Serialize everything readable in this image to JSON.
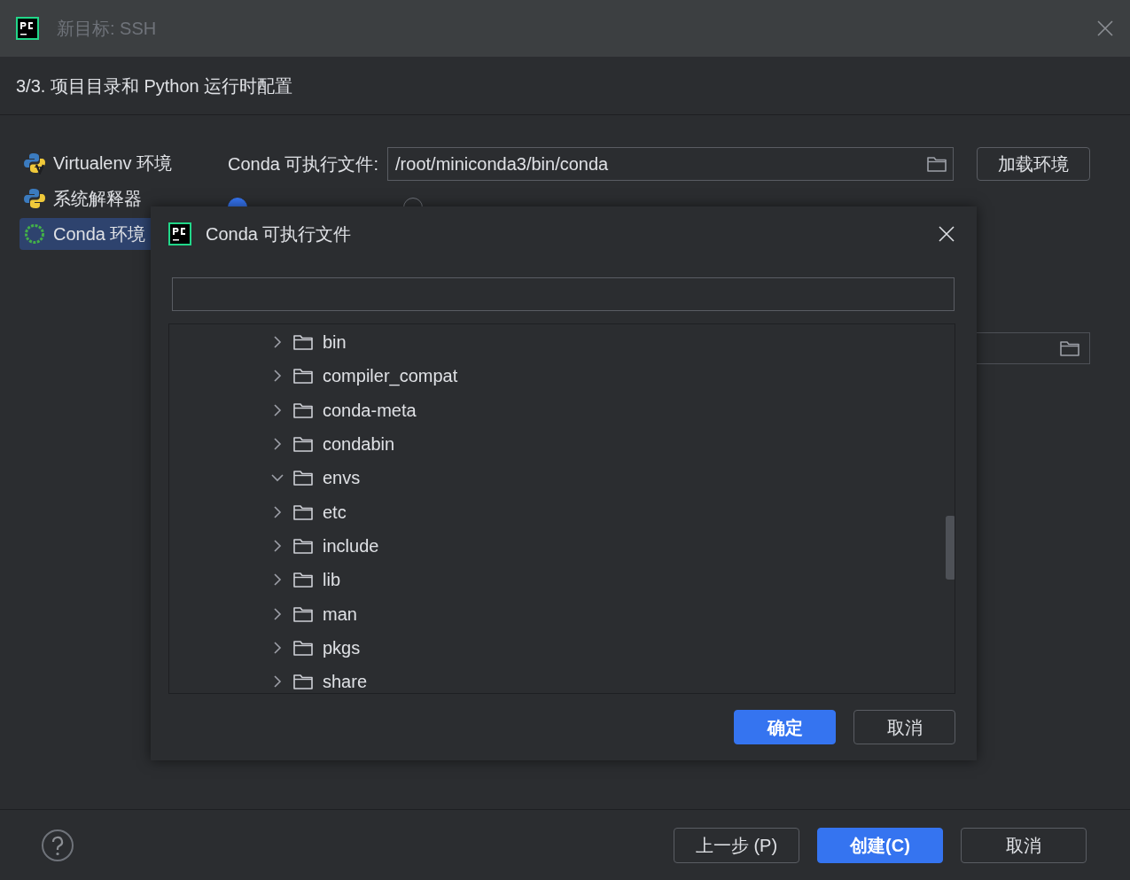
{
  "window": {
    "title": "新目标: SSH",
    "step_title": "3/3. 项目目录和 Python 运行时配置"
  },
  "sidebar": {
    "items": [
      {
        "label": "Virtualenv 环境",
        "kind": "virtualenv",
        "selected": false
      },
      {
        "label": "系统解释器",
        "kind": "python",
        "selected": false
      },
      {
        "label": "Conda 环境",
        "kind": "conda",
        "selected": true
      }
    ]
  },
  "conda_form": {
    "executable_label": "Conda 可执行文件:",
    "executable_value": "/root/miniconda3/bin/conda",
    "load_button": "加载环境",
    "options": [
      {
        "selected": true
      },
      {
        "selected": false
      }
    ]
  },
  "dialog": {
    "title": "Conda 可执行文件",
    "tree": [
      {
        "name": "bin",
        "expanded": false
      },
      {
        "name": "compiler_compat",
        "expanded": false
      },
      {
        "name": "conda-meta",
        "expanded": false
      },
      {
        "name": "condabin",
        "expanded": false
      },
      {
        "name": "envs",
        "expanded": true
      },
      {
        "name": "etc",
        "expanded": false
      },
      {
        "name": "include",
        "expanded": false
      },
      {
        "name": "lib",
        "expanded": false
      },
      {
        "name": "man",
        "expanded": false
      },
      {
        "name": "pkgs",
        "expanded": false
      },
      {
        "name": "share",
        "expanded": false
      }
    ],
    "ok_button": "确定",
    "cancel_button": "取消"
  },
  "footer": {
    "buttons": [
      {
        "label": "上一步 (P)",
        "kind": "default"
      },
      {
        "label": "创建(C)",
        "kind": "primary"
      },
      {
        "label": "取消",
        "kind": "default"
      }
    ]
  }
}
